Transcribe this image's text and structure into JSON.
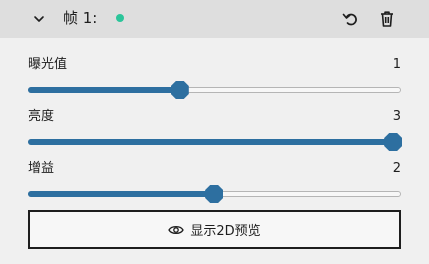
{
  "frame": {
    "title": "帧 1:",
    "status_color": "#2bc59a",
    "icons": {
      "collapse": "chevron-down-icon",
      "reset": "undo-icon",
      "delete": "trash-icon"
    }
  },
  "colors": {
    "accent": "#2d6fa0"
  },
  "sliders": [
    {
      "label": "曝光值",
      "value": "1",
      "fraction": 0.407
    },
    {
      "label": "亮度",
      "value": "3",
      "fraction": 0.979
    },
    {
      "label": "增益",
      "value": "2",
      "fraction": 0.499
    }
  ],
  "preview": {
    "label": "显示2D预览",
    "icon": "eye-icon"
  }
}
